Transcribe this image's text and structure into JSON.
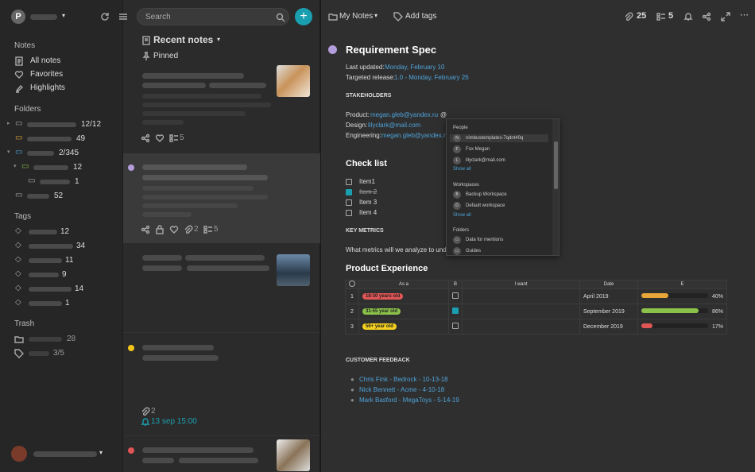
{
  "sidebar": {
    "avatar_letter": "P",
    "notes_heading": "Notes",
    "items": [
      {
        "label": "All notes",
        "icon": "note-icon"
      },
      {
        "label": "Favorites",
        "icon": "heart-icon"
      },
      {
        "label": "Highlights",
        "icon": "highlight-icon"
      }
    ],
    "folders_heading": "Folders",
    "folders": [
      {
        "count": "12/12",
        "color": "#aaa"
      },
      {
        "count": "49",
        "color": "#e8a53a"
      },
      {
        "count": "2/345",
        "color": "#4fa3d9"
      },
      {
        "count": "12",
        "color": "#8bc34a"
      },
      {
        "count": "1",
        "color": "#aaa"
      },
      {
        "count": "52",
        "color": "#aaa"
      }
    ],
    "tags_heading": "Tags",
    "tags": [
      "12",
      "34",
      "11",
      "9",
      "14",
      "1"
    ],
    "trash_heading": "Trash",
    "trash": [
      "28",
      "3/5"
    ]
  },
  "search": {
    "placeholder": "Search"
  },
  "notes": {
    "title": "Recent notes",
    "pinned": "Pinned",
    "card1_count": "5",
    "card2_attach": "2",
    "card2_count": "5",
    "card4_attach": "2",
    "card4_reminder": "13 sep 15:00"
  },
  "toolbar": {
    "folder": "My Notes",
    "add_tags": "Add tags",
    "attach_count": "25",
    "list_count": "5"
  },
  "doc": {
    "title": "Requirement Spec",
    "last_updated_label": "Last updated:",
    "last_updated": "Monday, February 10",
    "targeted_label": "Targeted release:",
    "targeted": "1.0 - Monday, February 26",
    "stakeholders": "STAKEHOLDERS",
    "product_label": "Product:",
    "product_email": "megan.gleb@yandex.ru",
    "product_at": "@",
    "design_label": "Design:",
    "design_email": "lilyclark@mail.com",
    "eng_label": "Engineering:",
    "eng_email": "megan.gleb@yandex.ru",
    "checklist": "Check list",
    "items": [
      {
        "label": "Item1",
        "checked": false
      },
      {
        "label": "Item 2",
        "checked": true
      },
      {
        "label": "Item 3",
        "checked": false
      },
      {
        "label": "Item 4",
        "checked": false
      }
    ],
    "key_metrics": "KEY METRICS",
    "metrics_text": "What metrics will we analyze to und",
    "product_exp": "Product Experience",
    "customer_feedback": "CUSTOMER FEEDBACK",
    "feedback": [
      "Chris Fink - Bedrock - 10-13-18",
      "Nick Bennett - Acme - 4-10-18",
      "Mark Basford - MegaToys - 5-14-19"
    ]
  },
  "table": {
    "headers": [
      "As a",
      "B",
      "I want",
      "Date",
      "E"
    ],
    "rows": [
      {
        "n": "1",
        "tag": "18-30 years old",
        "tag_color": "#e05555",
        "checked": false,
        "date": "April 2019",
        "pct": "40%",
        "fill": 0.4,
        "bar_color": "#e8a53a"
      },
      {
        "n": "2",
        "tag": "31-55 year old",
        "tag_color": "#8bc34a",
        "checked": true,
        "date": "September 2019",
        "pct": "86%",
        "fill": 0.86,
        "bar_color": "#8bc34a"
      },
      {
        "n": "3",
        "tag": "56+ year old",
        "tag_color": "#f5d020",
        "checked": false,
        "date": "December 2019",
        "pct": "17%",
        "fill": 0.17,
        "bar_color": "#e05555"
      }
    ]
  },
  "dropdown": {
    "people_heading": "People",
    "people": [
      {
        "initial": "N",
        "name": "nimbustemplates-7qdnt40q"
      },
      {
        "initial": "F",
        "name": "Fox Megan"
      },
      {
        "initial": "L",
        "name": "lilyclark@mail.com"
      }
    ],
    "show_all": "Show all",
    "workspaces_heading": "Workspaces",
    "workspaces": [
      {
        "initial": "B",
        "name": "Backup Workspace"
      },
      {
        "initial": "D",
        "name": "Default workspace"
      }
    ],
    "folders_heading": "Folders",
    "folders": [
      "Data for mentions",
      "Guides"
    ]
  }
}
